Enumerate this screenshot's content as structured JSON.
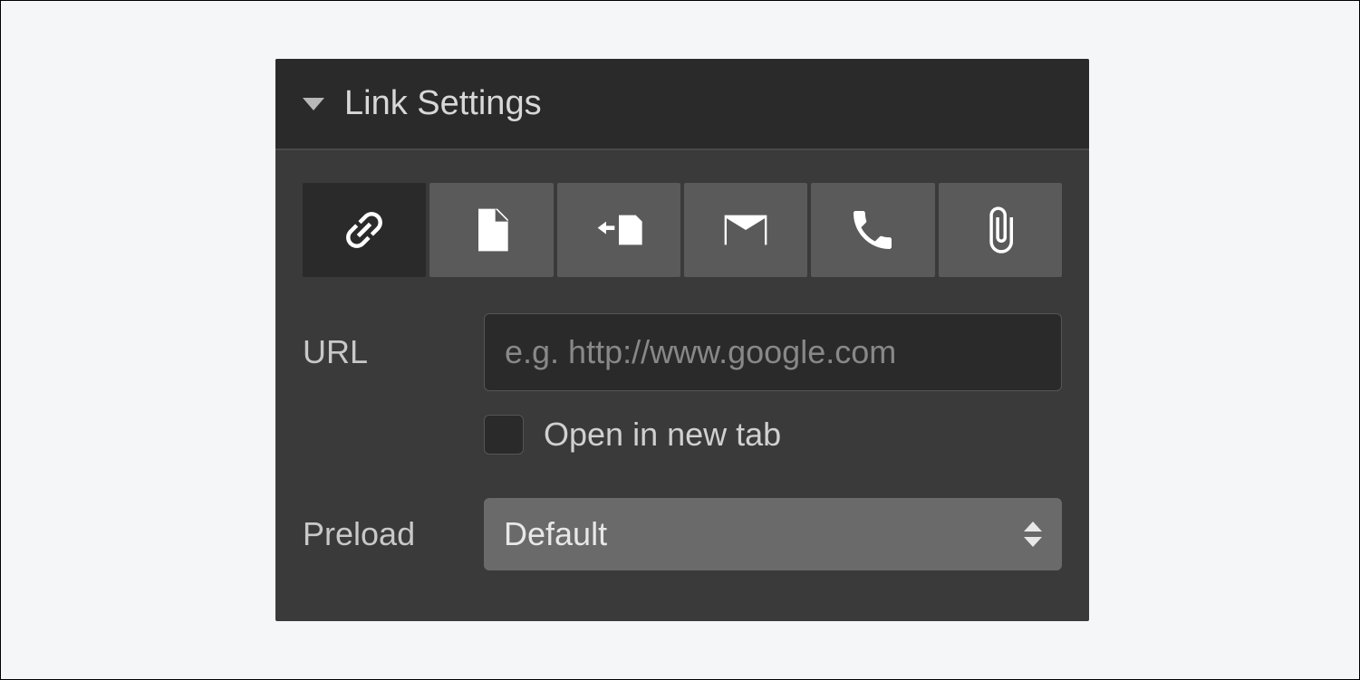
{
  "panel": {
    "title": "Link Settings",
    "tabs": [
      {
        "icon": "link-icon",
        "active": true
      },
      {
        "icon": "page-icon",
        "active": false
      },
      {
        "icon": "section-icon",
        "active": false
      },
      {
        "icon": "email-icon",
        "active": false
      },
      {
        "icon": "phone-icon",
        "active": false
      },
      {
        "icon": "attachment-icon",
        "active": false
      }
    ],
    "url": {
      "label": "URL",
      "placeholder": "e.g. http://www.google.com",
      "value": ""
    },
    "newTab": {
      "label": "Open in new tab",
      "checked": false
    },
    "preload": {
      "label": "Preload",
      "selected": "Default"
    }
  }
}
